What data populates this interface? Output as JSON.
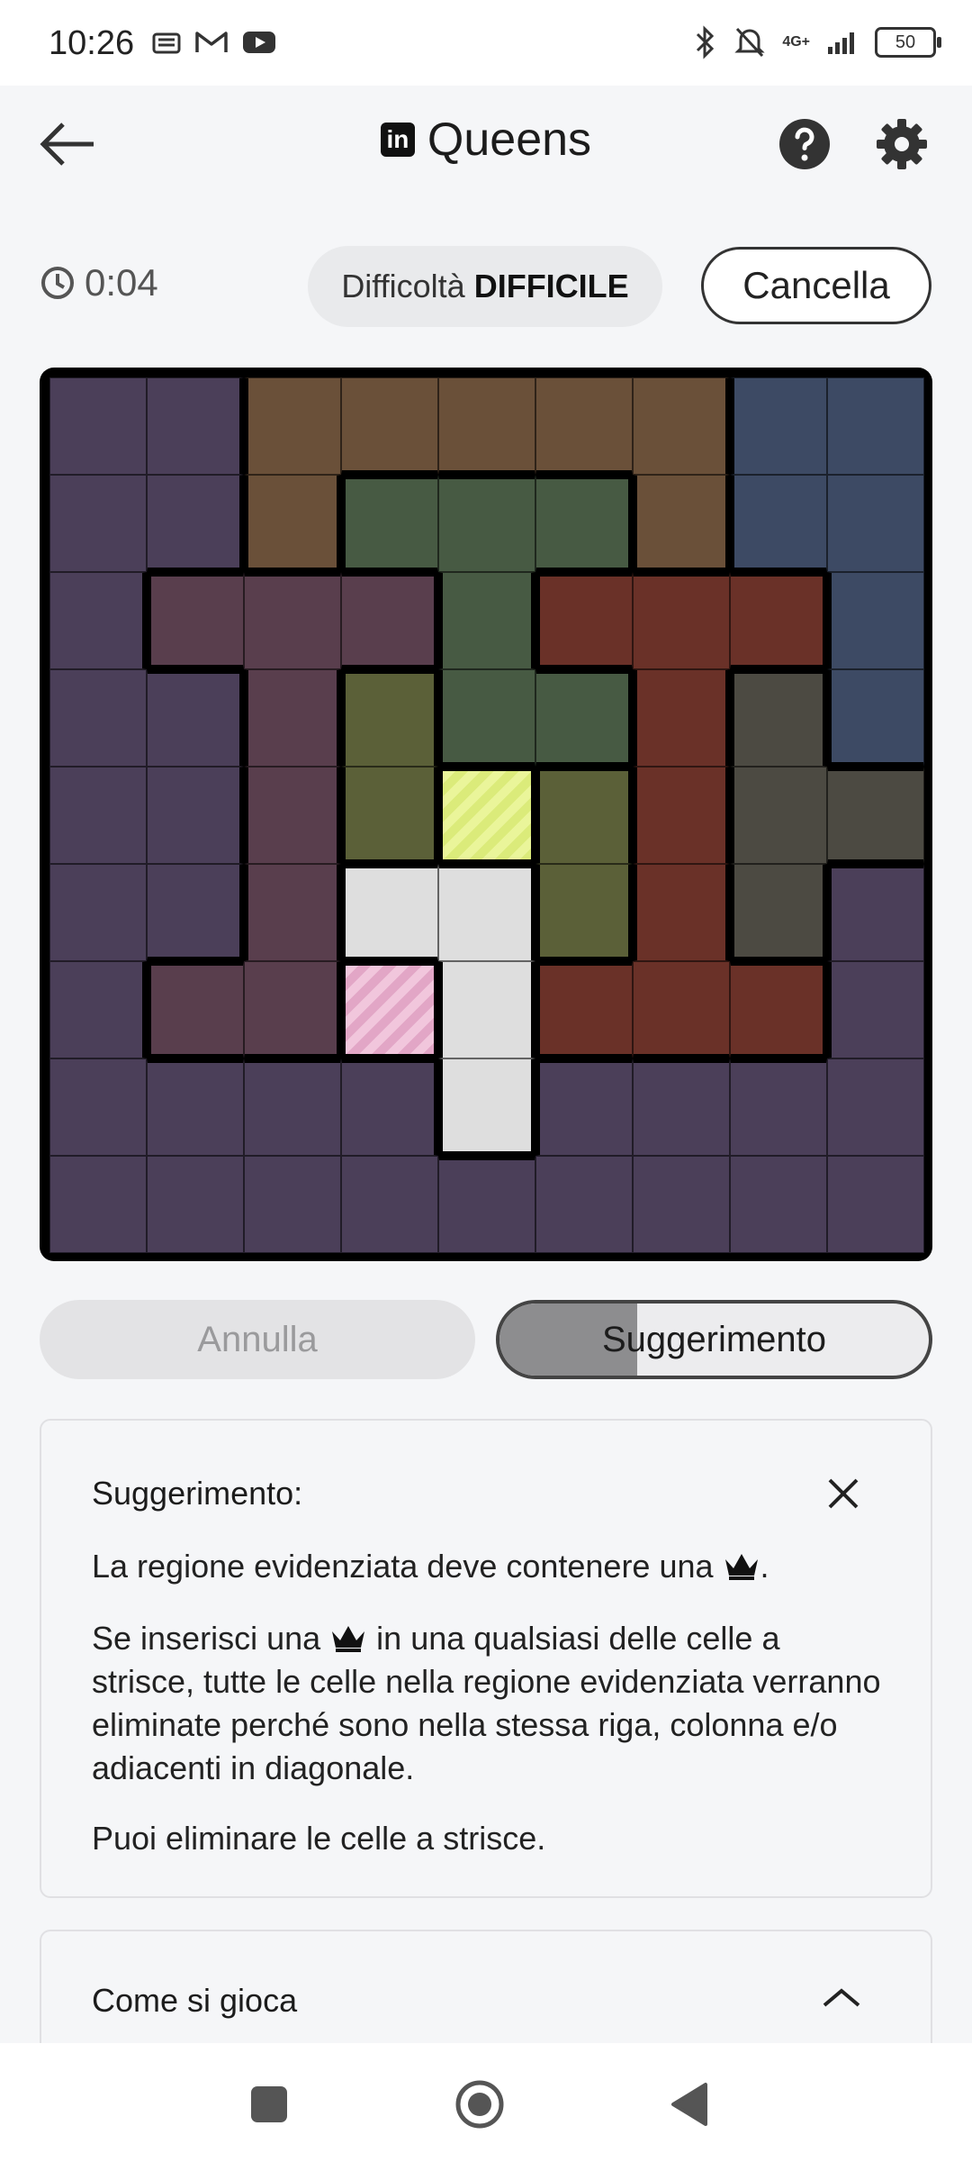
{
  "status": {
    "time": "10:26",
    "left_icons": [
      "sim-icon",
      "gmail-icon",
      "youtube-icon"
    ],
    "network": "4G+",
    "battery": "50"
  },
  "header": {
    "title": "Queens",
    "logo_text": "in"
  },
  "game": {
    "timer": "0:04",
    "difficulty_label": "Difficoltà",
    "difficulty_value": "DIFFICILE",
    "clear_label": "Cancella",
    "board": [
      [
        "P",
        "P",
        "B",
        "B",
        "B",
        "B",
        "B",
        "N",
        "N"
      ],
      [
        "P",
        "P",
        "B",
        "G",
        "G",
        "G",
        "B",
        "N",
        "N"
      ],
      [
        "P",
        "M",
        "M",
        "M",
        "G",
        "R",
        "R",
        "R",
        "N"
      ],
      [
        "P",
        "P",
        "M",
        "O",
        "G",
        "G",
        "R",
        "D",
        "N"
      ],
      [
        "P",
        "P",
        "M",
        "O",
        "Y",
        "O",
        "R",
        "D",
        "D"
      ],
      [
        "P",
        "P",
        "M",
        "L",
        "L",
        "O",
        "R",
        "D",
        "P"
      ],
      [
        "P",
        "M",
        "M",
        "K",
        "L",
        "R",
        "R",
        "R",
        "P"
      ],
      [
        "P",
        "P",
        "P",
        "P",
        "L",
        "P",
        "P",
        "P",
        "P"
      ],
      [
        "P",
        "P",
        "P",
        "P",
        "P",
        "P",
        "P",
        "P",
        "P"
      ]
    ],
    "regions": {
      "P": "#4b3f59",
      "B": "#6a5039",
      "N": "#3d4a64",
      "G": "#475a43",
      "M": "#593e4d",
      "R": "#6a3128",
      "O": "#5b6038",
      "D": "#4c4a42",
      "L": "#dedede",
      "Y": "#eaf59a",
      "K": "#f1c6dc"
    },
    "striped_cells": [
      "Y",
      "K"
    ]
  },
  "actions": {
    "undo_label": "Annulla",
    "hint_label": "Suggerimento",
    "hint_progress": 0.32
  },
  "hint": {
    "title": "Suggerimento:",
    "p1_before": "La regione evidenziata deve contenere una",
    "p1_after": ".",
    "p2_before": "Se inserisci una",
    "p2_after": "in una qualsiasi delle celle a strisce, tutte le celle nella regione evidenziata verranno eliminate perché sono nella stessa riga, colonna e/o adiacenti in diagonale.",
    "p3": "Puoi eliminare le celle a strisce."
  },
  "rules": {
    "title": "Come si gioca"
  },
  "colors": {
    "accent": "#1c1c1c",
    "board_border": "#000000",
    "background": "#f5f6f8"
  }
}
